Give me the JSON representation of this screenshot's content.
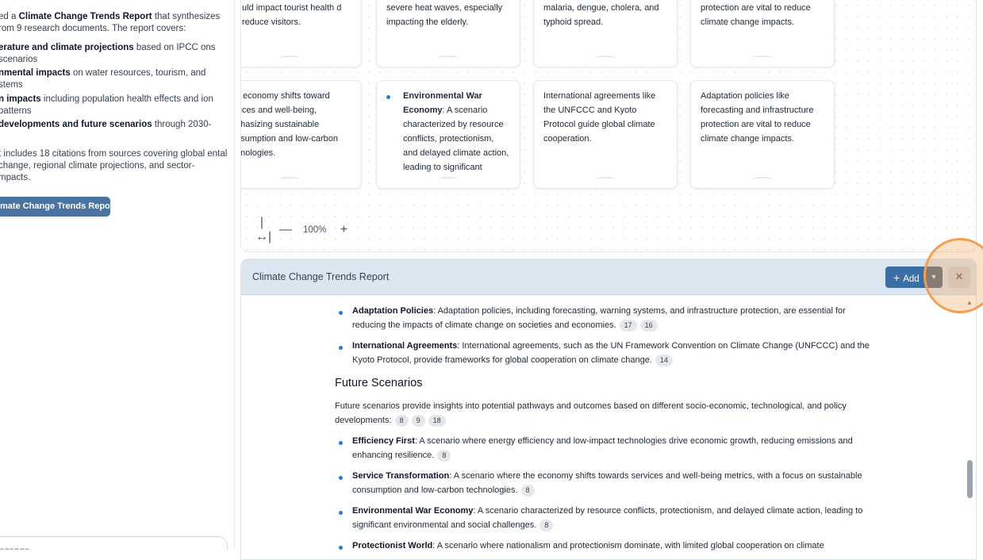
{
  "left_panel": {
    "intro_prefix": "ed a ",
    "intro_bold": "Climate Change Trends Report",
    "intro_suffix": " that synthesizes rom 9 research documents. The report covers:",
    "items": [
      {
        "bold": "erature and climate projections",
        "rest": " based on IPCC ons scenarios"
      },
      {
        "bold": "nmental impacts",
        "rest": " on water resources, tourism, and stems"
      },
      {
        "bold": "n impacts",
        "rest": " including population health effects and ion patterns"
      },
      {
        "bold": "developments and future scenarios",
        "rest": " through 2030-"
      }
    ],
    "citations_text": "t includes 18 citations from sources covering global ental change, regional climate projections, and sector- mpacts.",
    "report_button": "mate Change Trends Report",
    "message_placeholder": "essage"
  },
  "canvas": {
    "cards_row1": [
      "uld impact tourist health d reduce visitors.",
      "severe heat waves, especially impacting the elderly.",
      "malaria, dengue, cholera, and typhoid spread.",
      "protection are vital to reduce climate change impacts."
    ],
    "cards_row2": [
      {
        "text": "e economy shifts toward vices and well-being, phasizing sustainable nsumption and low-carbon hnologies."
      },
      {
        "bold": "Environmental War Economy",
        "text": ": A scenario characterized by resource conflicts, protectionism, and delayed climate action, leading to significant"
      },
      {
        "text": "International agreements like the UNFCCC and Kyoto Protocol guide global climate cooperation."
      },
      {
        "text": "Adaptation policies like forecasting and infrastructure protection are vital to reduce climate change impacts."
      }
    ],
    "zoom_level": "100%"
  },
  "report": {
    "title": "Climate Change Trends Report",
    "add_label": "Add",
    "items_top": [
      {
        "bold": "Adaptation Policies",
        "text": ": Adaptation policies, including forecasting, warning systems, and infrastructure protection, are essential for reducing the impacts of climate change on societies and economies.",
        "cites": [
          "17",
          "16"
        ]
      },
      {
        "bold": "International Agreements",
        "text": ": International agreements, such as the UN Framework Convention on Climate Change (UNFCCC) and the Kyoto Protocol, provide frameworks for global cooperation on climate change.",
        "cites": [
          "14"
        ]
      }
    ],
    "section_heading": "Future Scenarios",
    "section_para": "Future scenarios provide insights into potential pathways and outcomes based on different socio-economic, technological, and policy developments:",
    "section_cites": [
      "8",
      "9",
      "18"
    ],
    "scenarios": [
      {
        "bold": "Efficiency First",
        "text": ": A scenario where energy efficiency and low-impact technologies drive economic growth, reducing emissions and enhancing resilience.",
        "cites": [
          "8"
        ]
      },
      {
        "bold": "Service Transformation",
        "text": ": A scenario where the economy shifts towards services and well-being metrics, with a focus on sustainable consumption and low-carbon technologies.",
        "cites": [
          "8"
        ]
      },
      {
        "bold": "Environmental War Economy",
        "text": ": A scenario characterized by resource conflicts, protectionism, and delayed climate action, leading to significant environmental and social challenges.",
        "cites": [
          "8"
        ]
      },
      {
        "bold": "Protectionist World",
        "text": ": A scenario where nationalism and protectionism dominate, with limited global cooperation on climate",
        "cites": []
      }
    ]
  },
  "colors": {
    "accent": "#3b6ea5",
    "bullet": "#2b7bc0",
    "header_bg": "#dbe6f1",
    "highlight": "#f0a050"
  }
}
